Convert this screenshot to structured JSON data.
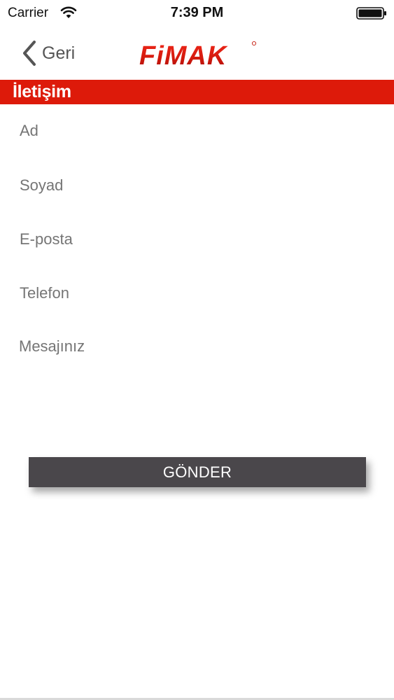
{
  "status_bar": {
    "carrier": "Carrier",
    "time": "7:39 PM"
  },
  "nav": {
    "back_label": "Geri",
    "logo_text": "FiMAK"
  },
  "section": {
    "title": "İletişim"
  },
  "form": {
    "name_placeholder": "Ad",
    "surname_placeholder": "Soyad",
    "email_placeholder": "E-posta",
    "phone_placeholder": "Telefon",
    "message_placeholder": "Mesajınız",
    "submit_label": "GÖNDER"
  },
  "colors": {
    "brand_red": "#dd1a0a",
    "button_dark": "#4a474b"
  },
  "icons": {
    "back": "chevron-left-icon",
    "wifi": "wifi-icon",
    "battery": "battery-icon"
  }
}
